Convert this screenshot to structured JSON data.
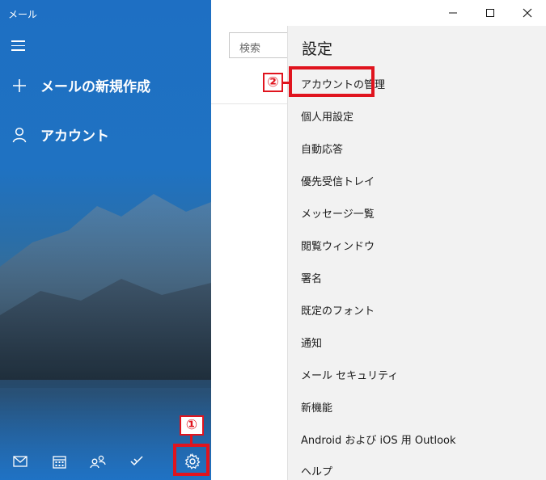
{
  "app": {
    "title": "メール"
  },
  "sidebar": {
    "new_mail_label": "メールの新規作成",
    "accounts_label": "アカウント"
  },
  "search": {
    "placeholder": "検索"
  },
  "settings": {
    "title": "設定",
    "items": [
      "アカウントの管理",
      "個人用設定",
      "自動応答",
      "優先受信トレイ",
      "メッセージ一覧",
      "閲覧ウィンドウ",
      "署名",
      "既定のフォント",
      "通知",
      "メール セキュリティ",
      "新機能",
      "Android および iOS 用 Outlook",
      "ヘルプ"
    ]
  },
  "annotations": {
    "step1": "①",
    "step2": "②",
    "color": "#e0141e"
  },
  "icons": {
    "bottom": [
      "mail-icon",
      "calendar-icon",
      "people-icon",
      "todo-icon",
      "settings-gear-icon"
    ],
    "titlebar": [
      "minimize-icon",
      "maximize-icon",
      "close-icon"
    ]
  },
  "colors": {
    "sidebar_blue": "#1f72c4",
    "settings_bg": "#f2f2f2"
  }
}
